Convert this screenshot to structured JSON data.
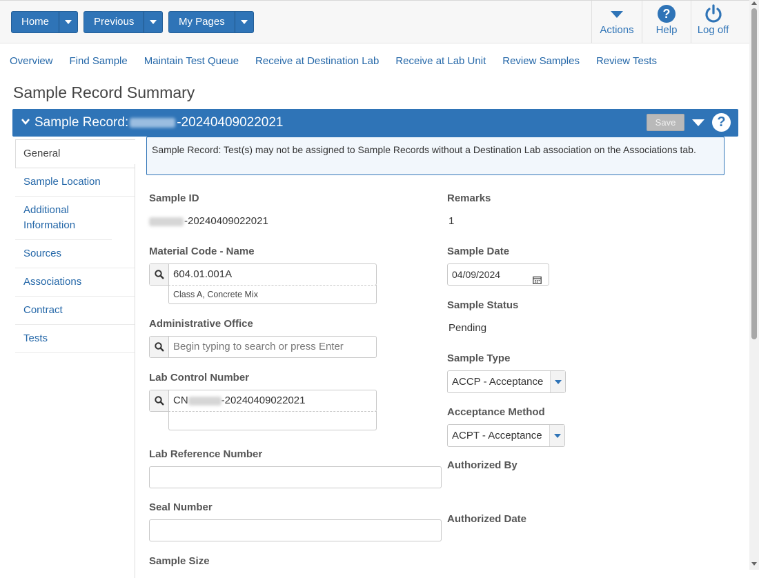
{
  "topbar": {
    "buttons": [
      {
        "label": "Home"
      },
      {
        "label": "Previous"
      },
      {
        "label": "My Pages"
      }
    ],
    "actions": {
      "label": "Actions"
    },
    "help": {
      "label": "Help"
    },
    "logoff": {
      "label": "Log off"
    }
  },
  "nav": {
    "links": [
      "Overview",
      "Find Sample",
      "Maintain Test Queue",
      "Receive at Destination Lab",
      "Receive at Lab Unit",
      "Review Samples",
      "Review Tests"
    ]
  },
  "page": {
    "title": "Sample Record Summary"
  },
  "record": {
    "header_prefix": "Sample Record:",
    "id_suffix": "-20240409022021",
    "save_label": "Save",
    "help_glyph": "?"
  },
  "tabs": [
    "General",
    "Sample Location",
    "Additional Information",
    "Sources",
    "Associations",
    "Contract",
    "Tests"
  ],
  "alert": {
    "text": "Sample Record: Test(s) may not be assigned to Sample Records without a Destination Lab association on the Associations tab."
  },
  "form": {
    "sample_id": {
      "label": "Sample ID",
      "value_suffix": "-20240409022021"
    },
    "material": {
      "label": "Material Code - Name",
      "value": "604.01.001A",
      "description": "Class A, Concrete Mix"
    },
    "admin_office": {
      "label": "Administrative Office",
      "placeholder": "Begin typing to search or press Enter"
    },
    "lab_control": {
      "label": "Lab Control Number",
      "prefix": "CN",
      "suffix": "-20240409022021"
    },
    "lab_reference": {
      "label": "Lab Reference Number"
    },
    "seal_number": {
      "label": "Seal Number"
    },
    "sample_size": {
      "label": "Sample Size"
    },
    "remarks": {
      "label": "Remarks",
      "value": "1"
    },
    "sample_date": {
      "label": "Sample Date",
      "value": "04/09/2024"
    },
    "sample_status": {
      "label": "Sample Status",
      "value": "Pending"
    },
    "sample_type": {
      "label": "Sample Type",
      "value": "ACCP - Acceptance"
    },
    "acceptance_method": {
      "label": "Acceptance Method",
      "value": "ACPT - Acceptance"
    },
    "authorized_by": {
      "label": "Authorized By"
    },
    "authorized_date": {
      "label": "Authorized Date"
    }
  },
  "colors": {
    "primary": "#2f74b7",
    "link": "#2467a8",
    "alert_bg": "#f2f7fc"
  }
}
